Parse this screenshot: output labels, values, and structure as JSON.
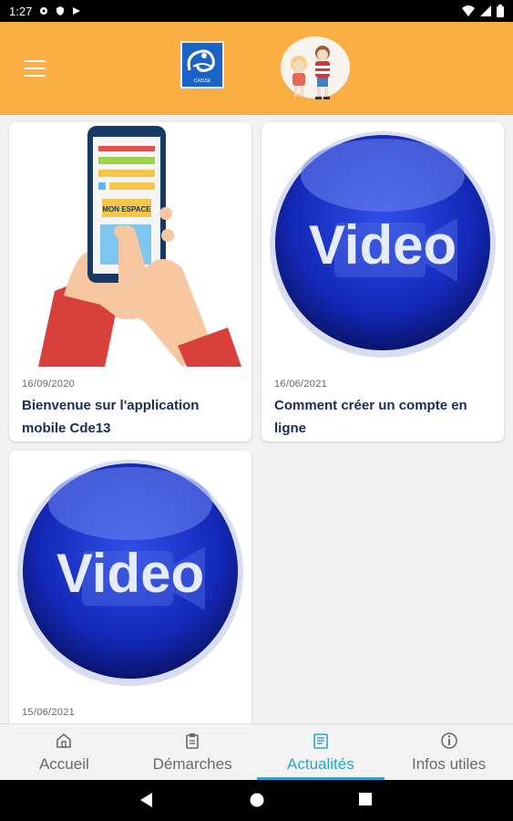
{
  "status_bar": {
    "time": "1:27"
  },
  "app_bar": {
    "logo_caisse_text": "CAISSE"
  },
  "news": [
    {
      "date": "16/09/2020",
      "title": "Bienvenue sur l'application mobile Cde13",
      "image": "mon-espace-phone",
      "image_text": "MON ESPACE"
    },
    {
      "date": "16/06/2021",
      "title": "Comment créer un compte en ligne",
      "image": "video-button",
      "image_text": "Video"
    },
    {
      "date": "15/06/2021",
      "title": "",
      "image": "video-button",
      "image_text": "Video"
    }
  ],
  "bottom_nav": [
    {
      "label": "Accueil",
      "icon": "home-icon",
      "active": false
    },
    {
      "label": "Démarches",
      "icon": "clipboard-icon",
      "active": false
    },
    {
      "label": "Actualités",
      "icon": "newspaper-icon",
      "active": true
    },
    {
      "label": "Infos utiles",
      "icon": "info-icon",
      "active": false
    }
  ],
  "colors": {
    "app_bar": "#fbae43",
    "accent": "#2aa2d6",
    "title": "#1a2e55",
    "logo_blue": "#1c63c8"
  }
}
